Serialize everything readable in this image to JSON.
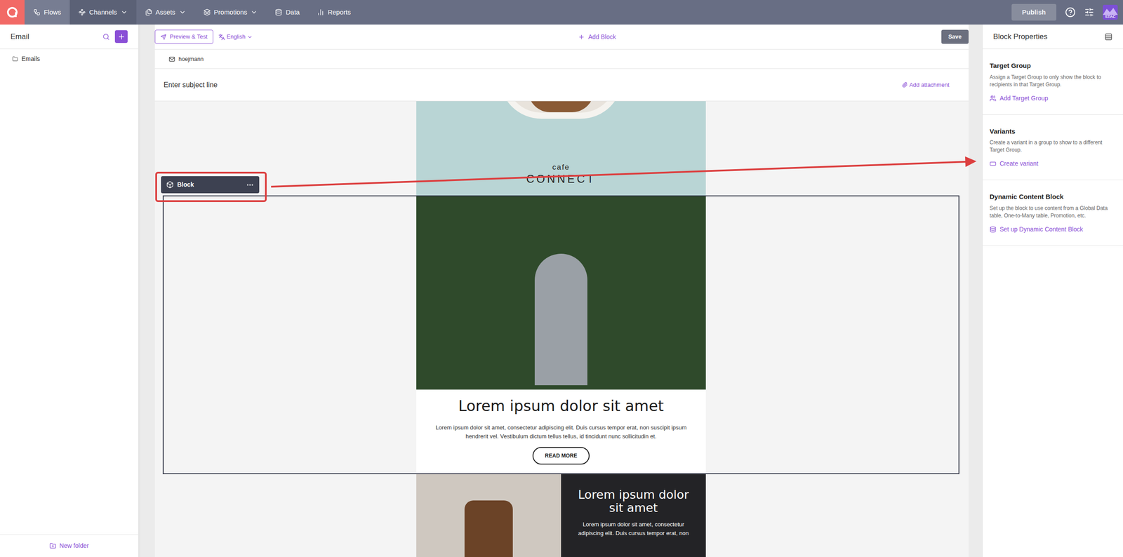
{
  "nav": {
    "items": [
      {
        "label": "Flows",
        "icon": "flows",
        "dropdown": false,
        "selected": false,
        "highlighted": true
      },
      {
        "label": "Channels",
        "icon": "channels",
        "dropdown": true,
        "selected": true,
        "highlighted": false
      },
      {
        "label": "Assets",
        "icon": "assets",
        "dropdown": true,
        "selected": false,
        "highlighted": false
      },
      {
        "label": "Promotions",
        "icon": "promotions",
        "dropdown": true,
        "selected": false,
        "highlighted": false
      },
      {
        "label": "Data",
        "icon": "data",
        "dropdown": false,
        "selected": false,
        "highlighted": false
      },
      {
        "label": "Reports",
        "icon": "reports",
        "dropdown": false,
        "selected": false,
        "highlighted": false
      }
    ],
    "publish": "Publish",
    "avatar": "STAC"
  },
  "sidebar": {
    "title": "Email",
    "folders": [
      "Emails"
    ],
    "new_folder": "New folder"
  },
  "toolbar": {
    "preview": "Preview & Test",
    "language": "English",
    "add_block": "Add Block",
    "save": "Save"
  },
  "email": {
    "from": "hoejmann",
    "subject_placeholder": "Enter subject line",
    "attachment": "Add attachment"
  },
  "canvas": {
    "brand_small": "cafe",
    "brand": "CONNECT",
    "block_label": "Block",
    "selected_block": {
      "heading": "Lorem ipsum dolor sit amet",
      "body": "Lorem ipsum dolor sit amet, consectetur adipiscing elit. Duis cursus tempor erat, non suscipit ipsum hendrerit vel. Vestibulum dictum tellus tellus, id tincidunt nunc sollicitudin et.",
      "button": "READ MORE"
    },
    "next_block": {
      "heading": "Lorem ipsum dolor sit amet",
      "body": "Lorem ipsum dolor sit amet, consectetur adipiscing elit. Duis cursus tempor erat, non"
    }
  },
  "properties": {
    "title": "Block Properties",
    "sections": [
      {
        "title": "Target Group",
        "description": "Assign a Target Group to only show the block to recipients in that Target Group.",
        "action": "Add Target Group",
        "icon": "users"
      },
      {
        "title": "Variants",
        "description": "Create a variant in a group to show to a different Target Group.",
        "action": "Create variant",
        "icon": "variant"
      },
      {
        "title": "Dynamic Content Block",
        "description": "Set up the block to use content from a Global Data table, One-to-Many table, Promotion, etc.",
        "action": "Set up Dynamic Content Block",
        "icon": "database"
      }
    ]
  }
}
